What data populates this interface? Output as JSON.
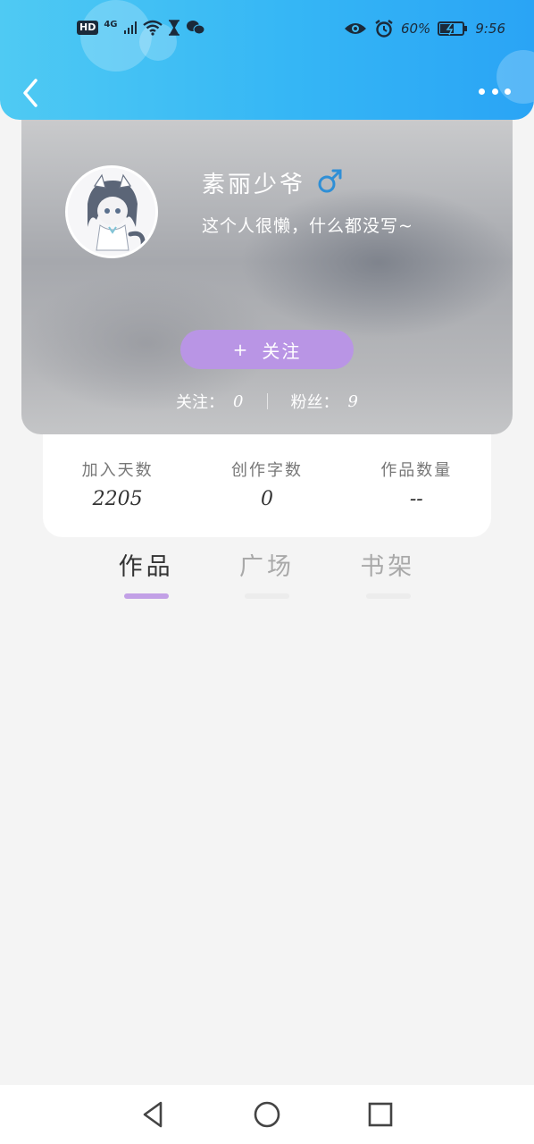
{
  "status_bar": {
    "hd": "HD",
    "network": "4G",
    "battery": "60%",
    "time": "9:56",
    "icons": [
      "signal-icon",
      "wifi-icon",
      "hourglass-icon",
      "wechat-icon",
      "eye-icon",
      "alarm-icon",
      "battery-icon"
    ]
  },
  "header": {
    "back_icon": "chevron-left-icon",
    "more_icon": "more-dots-icon"
  },
  "profile": {
    "username": "素丽少爷",
    "gender_icon": "male-icon",
    "bio": "这个人很懒，什么都没写~",
    "follow_button": {
      "plus": "+",
      "label": "关注"
    },
    "following_label": "关注：",
    "following_count": "0",
    "followers_label": "粉丝：",
    "followers_count": "9"
  },
  "info": [
    {
      "label": "加入天数",
      "value": "2205"
    },
    {
      "label": "创作字数",
      "value": "0"
    },
    {
      "label": "作品数量",
      "value": "--"
    }
  ],
  "tabs": [
    {
      "label": "作品",
      "active": true
    },
    {
      "label": "广场",
      "active": false
    },
    {
      "label": "书架",
      "active": false
    }
  ],
  "colors": {
    "header_start": "#4fcaf3",
    "header_end": "#2aa4f5",
    "accent_purple": "#b995e5",
    "male_blue": "#2f8fd6"
  },
  "system_nav": [
    "back-triangle-icon",
    "home-circle-icon",
    "recents-square-icon"
  ]
}
